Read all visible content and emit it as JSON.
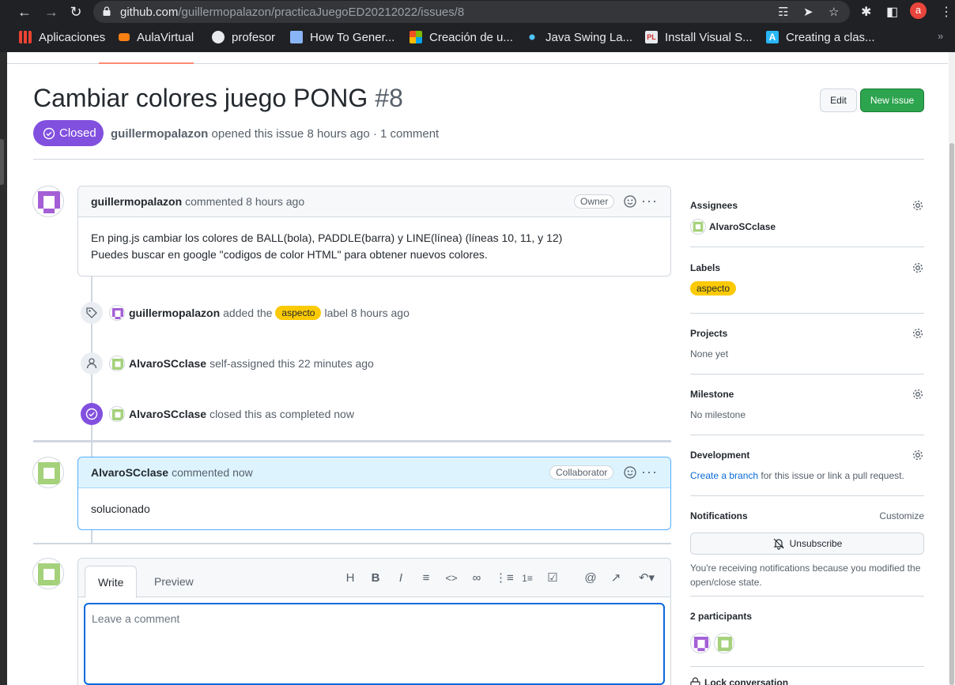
{
  "browser": {
    "url_host": "github.com",
    "url_path": "/guillermopalazon/practicaJuegoED20212022/issues/8",
    "profile_initial": "a",
    "bookmarks": [
      {
        "label": "Aplicaciones",
        "icon": "apps-grid-icon"
      },
      {
        "label": "AulaVirtual",
        "icon": "moodle-icon"
      },
      {
        "label": "profesor",
        "icon": "globe-icon"
      },
      {
        "label": "How To Gener...",
        "icon": "tool-icon"
      },
      {
        "label": "Creación de u...",
        "icon": "microsoft-icon"
      },
      {
        "label": "Java Swing La...",
        "icon": "network-icon"
      },
      {
        "label": "Install Visual S...",
        "icon": "pl-icon"
      },
      {
        "label": "Creating a clas...",
        "icon": "a-icon"
      }
    ]
  },
  "issue": {
    "title": "Cambiar colores juego PONG",
    "number": "#8",
    "state": "Closed",
    "author": "guillermopalazon",
    "meta_text": "opened this issue 8 hours ago · 1 comment",
    "edit_label": "Edit",
    "new_issue_label": "New issue"
  },
  "comments": [
    {
      "author": "guillermopalazon",
      "action": "commented 8 hours ago",
      "role": "Owner",
      "body_lines": [
        "En ping.js cambiar los colores de BALL(bola), PADDLE(barra) y LINE(línea) (líneas 10, 11, y 12)",
        "Puedes buscar en google \"codigos de color HTML\" para obtener nuevos colores."
      ]
    },
    {
      "author": "AlvaroSCclase",
      "action": "commented now",
      "role": "Collaborator",
      "body_lines": [
        "solucionado"
      ]
    }
  ],
  "events": [
    {
      "actor": "guillermopalazon",
      "pre": "added the",
      "label": "aspecto",
      "post": "label 8 hours ago",
      "icon": "tag-icon"
    },
    {
      "actor": "AlvaroSCclase",
      "text": "self-assigned this 22 minutes ago",
      "icon": "person-icon"
    },
    {
      "actor": "AlvaroSCclase",
      "text": "closed this as completed now",
      "icon": "check-circle-icon"
    }
  ],
  "editor": {
    "tab_write": "Write",
    "tab_preview": "Preview",
    "placeholder": "Leave a comment",
    "tools": [
      "heading-icon",
      "bold-icon",
      "italic-icon",
      "quote-icon",
      "code-icon",
      "link-icon",
      "bullet-list-icon",
      "numbered-list-icon",
      "task-list-icon",
      "mention-icon",
      "reference-icon",
      "reply-icon"
    ]
  },
  "sidebar": {
    "assignees": {
      "title": "Assignees",
      "value": "AlvaroSCclase"
    },
    "labels": {
      "title": "Labels",
      "value": "aspecto"
    },
    "projects": {
      "title": "Projects",
      "value": "None yet"
    },
    "milestone": {
      "title": "Milestone",
      "value": "No milestone"
    },
    "development": {
      "title": "Development",
      "link": "Create a branch",
      "rest": "for this issue or link a pull request."
    },
    "notifications": {
      "title": "Notifications",
      "customize": "Customize",
      "button": "Unsubscribe",
      "note": "You're receiving notifications because you modified the open/close state."
    },
    "participants": {
      "title": "2 participants"
    },
    "lock": {
      "title": "Lock conversation"
    }
  },
  "colors": {
    "closed_purple": "#8250df",
    "label_yellow": "#fbca04",
    "primary_green": "#2da44e",
    "link_blue": "#0969da"
  }
}
